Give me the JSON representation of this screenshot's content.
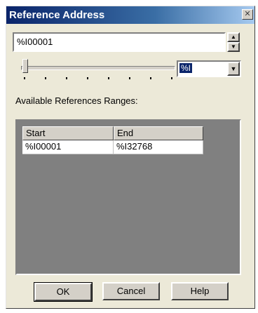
{
  "window": {
    "title": "Reference Address",
    "close_glyph": "✕"
  },
  "address": {
    "value": "%I00001"
  },
  "type_combo": {
    "value": "%I"
  },
  "ranges": {
    "label": "Available References Ranges:",
    "columns": [
      "Start",
      "End"
    ],
    "rows": [
      {
        "start": "%I00001",
        "end": "%I32768"
      }
    ]
  },
  "buttons": {
    "ok": "OK",
    "cancel": "Cancel",
    "help": "Help"
  }
}
